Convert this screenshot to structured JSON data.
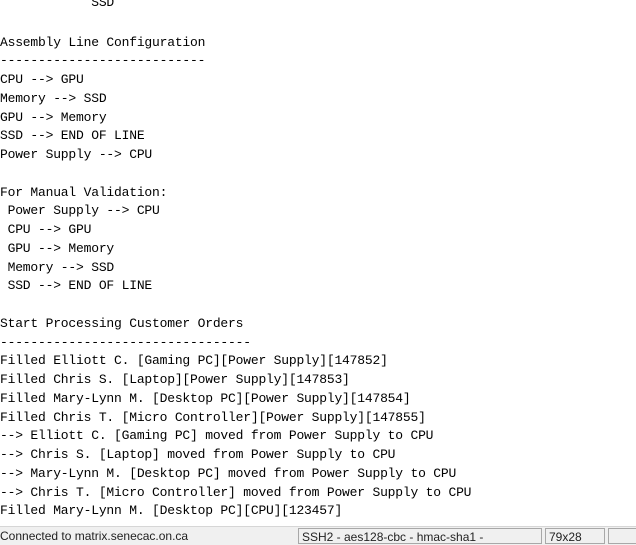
{
  "terminal": {
    "lines": [
      "            SSD",
      "",
      "Assembly Line Configuration",
      "---------------------------",
      "CPU --> GPU",
      "Memory --> SSD",
      "GPU --> Memory",
      "SSD --> END OF LINE",
      "Power Supply --> CPU",
      "",
      "For Manual Validation:",
      " Power Supply --> CPU",
      " CPU --> GPU",
      " GPU --> Memory",
      " Memory --> SSD",
      " SSD --> END OF LINE",
      "",
      "Start Processing Customer Orders",
      "---------------------------------",
      "Filled Elliott C. [Gaming PC][Power Supply][147852]",
      "Filled Chris S. [Laptop][Power Supply][147853]",
      "Filled Mary-Lynn M. [Desktop PC][Power Supply][147854]",
      "Filled Chris T. [Micro Controller][Power Supply][147855]",
      "--> Elliott C. [Gaming PC] moved from Power Supply to CPU",
      "--> Chris S. [Laptop] moved from Power Supply to CPU",
      "--> Mary-Lynn M. [Desktop PC] moved from Power Supply to CPU",
      "--> Chris T. [Micro Controller] moved from Power Supply to CPU",
      "Filled Mary-Lynn M. [Desktop PC][CPU][123457]"
    ]
  },
  "statusbar": {
    "connection": "Connected to matrix.senecac.on.ca",
    "cipher": "SSH2 - aes128-cbc - hmac-sha1 - ",
    "size": "79x28",
    "extra": ""
  }
}
